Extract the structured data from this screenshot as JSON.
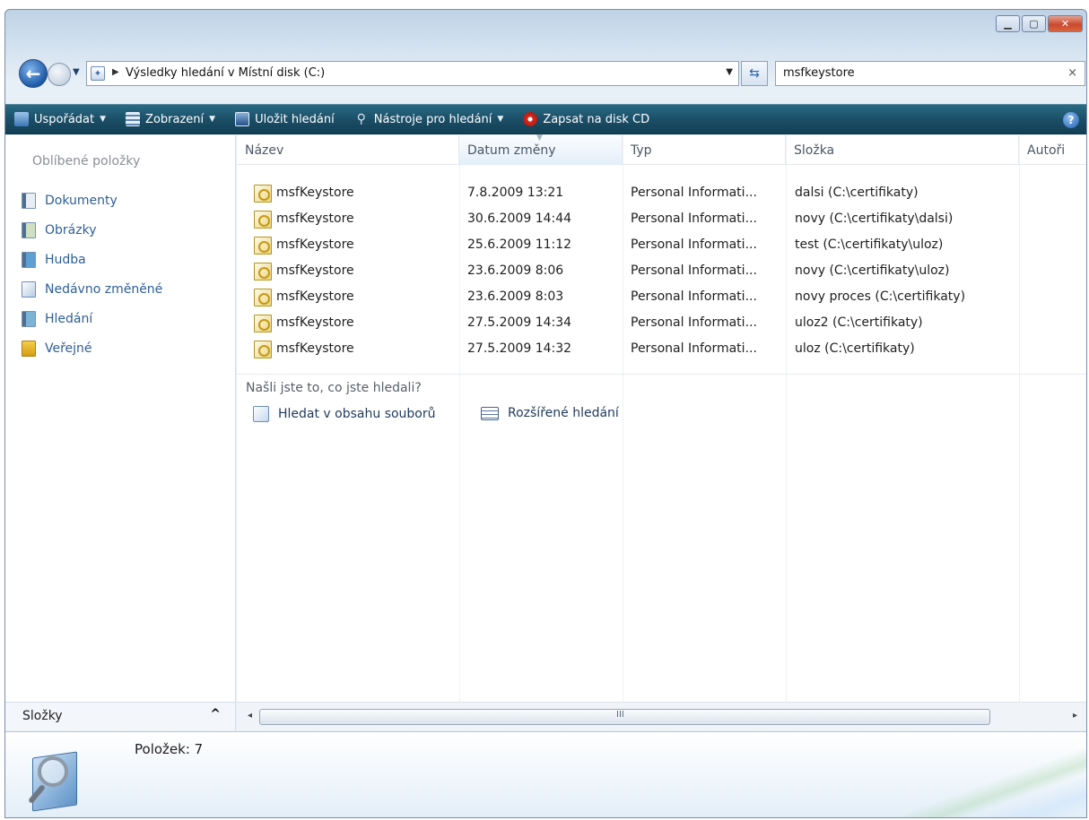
{
  "address": {
    "path": "Výsledky hledání v Místní disk (C:)"
  },
  "search": {
    "query": "msfkeystore",
    "clear": "×"
  },
  "toolbar": {
    "organize": "Uspořádat",
    "views": "Zobrazení",
    "save_search": "Uložit hledání",
    "search_tools": "Nástroje pro hledání",
    "burn": "Zapsat na disk CD",
    "help": "?"
  },
  "sidebar": {
    "favorites_title": "Oblíbené položky",
    "items": [
      {
        "label": "Dokumenty",
        "icon": "documents-icon"
      },
      {
        "label": "Obrázky",
        "icon": "pictures-icon"
      },
      {
        "label": "Hudba",
        "icon": "music-icon"
      },
      {
        "label": "Nedávno změněné",
        "icon": "recent-icon"
      },
      {
        "label": "Hledání",
        "icon": "searches-icon"
      },
      {
        "label": "Veřejné",
        "icon": "public-folder-icon"
      }
    ],
    "folders_label": "Složky",
    "folders_chevron": "^"
  },
  "columns": {
    "name": "Název",
    "date": "Datum změny",
    "type": "Typ",
    "folder": "Složka",
    "authors": "Autoři"
  },
  "files": [
    {
      "name": "msfKeystore",
      "date": "7.8.2009 13:21",
      "type": "Personal Informati...",
      "folder": "dalsi (C:\\certifikaty)"
    },
    {
      "name": "msfKeystore",
      "date": "30.6.2009 14:44",
      "type": "Personal Informati...",
      "folder": "novy (C:\\certifikaty\\dalsi)"
    },
    {
      "name": "msfKeystore",
      "date": "25.6.2009 11:12",
      "type": "Personal Informati...",
      "folder": "test (C:\\certifikaty\\uloz)"
    },
    {
      "name": "msfKeystore",
      "date": "23.6.2009 8:06",
      "type": "Personal Informati...",
      "folder": "novy (C:\\certifikaty\\uloz)"
    },
    {
      "name": "msfKeystore",
      "date": "23.6.2009 8:03",
      "type": "Personal Informati...",
      "folder": "novy proces (C:\\certifikaty)"
    },
    {
      "name": "msfKeystore",
      "date": "27.5.2009 14:34",
      "type": "Personal Informati...",
      "folder": "uloz2 (C:\\certifikaty)"
    },
    {
      "name": "msfKeystore",
      "date": "27.5.2009 14:32",
      "type": "Personal Informati...",
      "folder": "uloz (C:\\certifikaty)"
    }
  ],
  "search_hint": {
    "question": "Našli jste to, co jste hledali?",
    "search_contents": "Hledat v obsahu souborů",
    "advanced": "Rozšířené hledání"
  },
  "scrollbar": {
    "left": "◂",
    "right": "▸",
    "grip": "III"
  },
  "details": {
    "count": "Položek: 7"
  },
  "colors": {
    "toolbar": "#1b4f67",
    "link": "#2e5e98",
    "close": "#c94a2f"
  }
}
